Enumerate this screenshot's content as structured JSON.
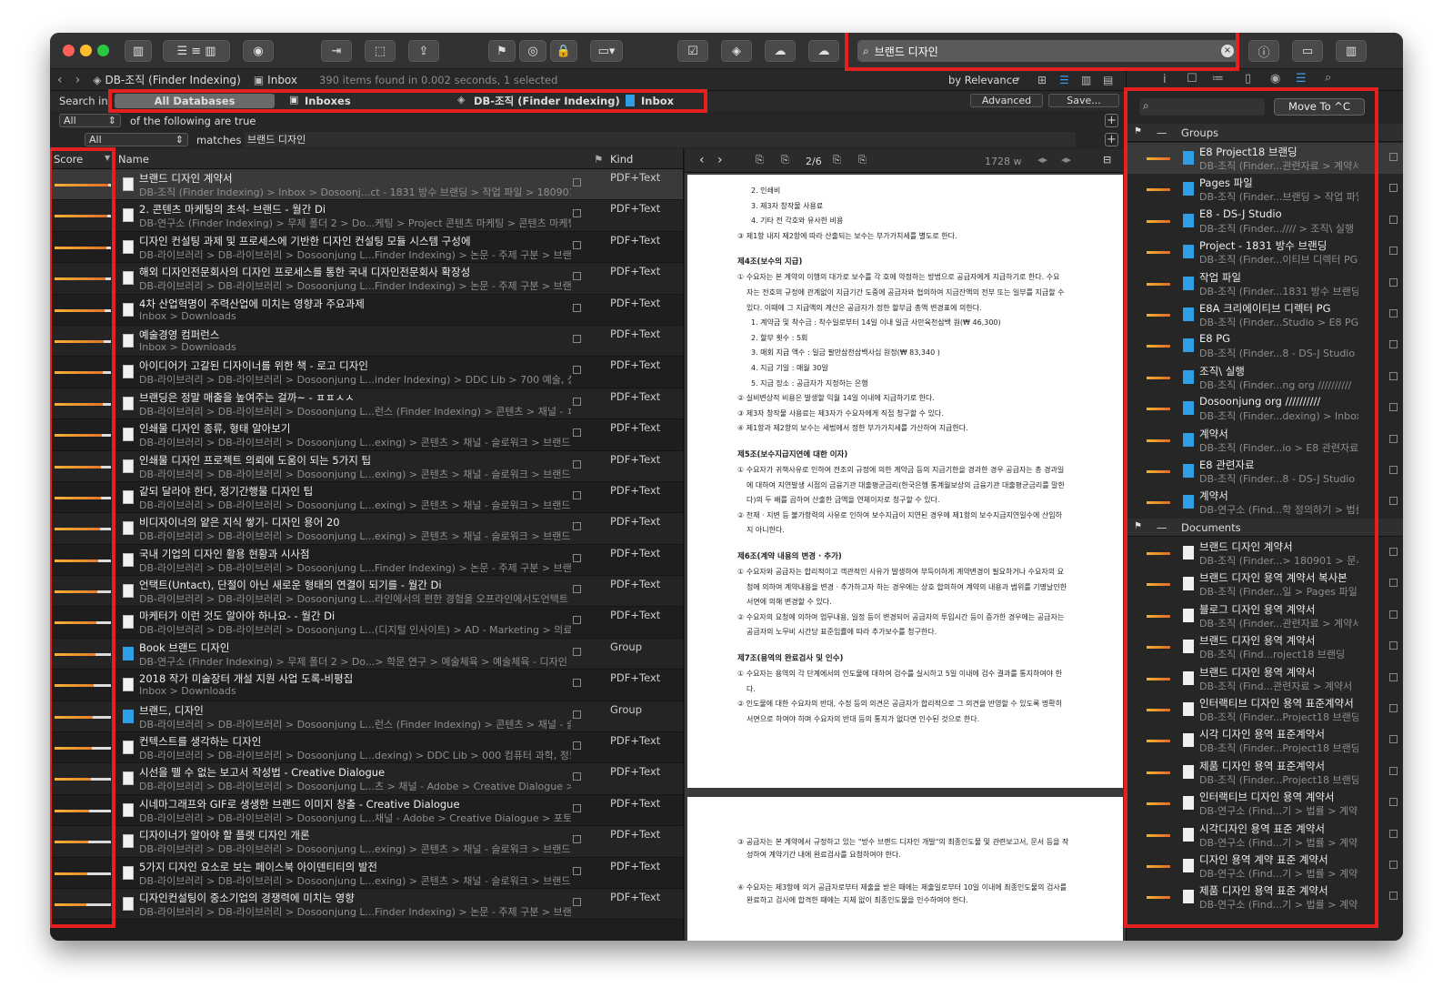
{
  "toolbar": {
    "search_value": "브랜드 디자인",
    "search_clear": "×"
  },
  "pathbar": {
    "db_label": "DB-조직 (Finder Indexing)",
    "inbox_label": "Inbox",
    "status": "390 items found in 0.002 seconds, 1 selected",
    "sort": "by Relevance"
  },
  "scope": {
    "label": "Search in:",
    "items": [
      "All Databases",
      "Inboxes",
      "DB-조직 (Finder Indexing)",
      "Inbox"
    ],
    "advanced": "Advanced",
    "save": "Save..."
  },
  "criteria": {
    "row1_select": "All",
    "row1_text": "of the following are true",
    "row2_select": "All",
    "row2_op": "matches",
    "row2_value": "브랜드 디자인"
  },
  "list": {
    "col_score": "Score",
    "col_name": "Name",
    "col_kind": "Kind",
    "rows": [
      {
        "t": "브랜드 디자인 계약서",
        "p": "DB-조직 (Finder Indexing) > Inbox > Dosoonj...ct - 1831 방수 브랜딩 > 작업 파일 > 180901 > 문서",
        "k": "PDF+Text",
        "s": 0.95
      },
      {
        "t": "2. 콘텐츠 마케팅의 초석- 브랜드 - 월간 Di",
        "p": "DB-연구소 (Finder Indexing) > 무제 폴더 2 > Do...케팅 > Project 콘텐츠 마케팅 > 콘텐츠 마케팅의 정의",
        "k": "PDF+Text",
        "s": 0.93
      },
      {
        "t": "디자인 컨설팅 과제 및 프로세스에 기반한 디자인 컨설팅 모듈 시스템 구성에",
        "p": "DB-라이브러리 > DB-라이브러리 > Dosoonjung L...Finder Indexing) > 논문 - 주제 구분 > 브랜딩 논문",
        "k": "PDF+Text",
        "s": 0.92
      },
      {
        "t": "해외 디자인전문회사의 디자인 프로세스를 통한 국내 디자인전문회사 확장성",
        "p": "DB-라이브러리 > DB-라이브러리 > Dosoonjung L...Finder Indexing) > 논문 - 주제 구분 > 브랜딩 논문",
        "k": "PDF+Text",
        "s": 0.9
      },
      {
        "t": "4차 산업혁명이 주력산업에 미치는 영향과 주요과제",
        "p": "Inbox > Downloads",
        "k": "PDF+Text",
        "s": 0.88
      },
      {
        "t": "예술경영 컴퍼런스",
        "p": "Inbox > Downloads",
        "k": "PDF+Text",
        "s": 0.87
      },
      {
        "t": "아이디어가 고갈된 디자이너를 위한 책 - 로고 디자인",
        "p": "DB-라이브러리 > DB-라이브러리 > Dosoonjung L...inder Indexing) > DDC Lib > 700 예술, 상식예술",
        "k": "PDF+Text",
        "s": 0.86
      },
      {
        "t": "브랜딩은 정말 매출을 높여주는 걸까~ - ㅍㅍㅅㅅ",
        "p": "DB-라이브러리 > DB-라이브러리 > Dosoonjung L...런스 (Finder Indexing) > 콘텐츠 > 채널 - ㅍㅍㅅㅅ",
        "k": "PDF+Text",
        "s": 0.85
      },
      {
        "t": "인쇄물 디자인 종류, 형태 알아보기",
        "p": "DB-라이브러리 > DB-라이브러리 > Dosoonjung L...exing) > 콘텐츠 > 채널 - 슬로워크 > 브랜드, 디자인",
        "k": "PDF+Text",
        "s": 0.84
      },
      {
        "t": "인쇄물 디자인 프로젝트 의뢰에 도움이 되는 5가지 팁",
        "p": "DB-라이브러리 > DB-라이브러리 > Dosoonjung L...exing) > 콘텐츠 > 채널 - 슬로워크 > 브랜드, 디자인",
        "k": "PDF+Text",
        "s": 0.83
      },
      {
        "t": "같되 달라야 한다, 정기간행물 디자인 팁",
        "p": "DB-라이브러리 > DB-라이브러리 > Dosoonjung L...exing) > 콘텐츠 > 채널 - 슬로워크 > 브랜드, 디자인",
        "k": "PDF+Text",
        "s": 0.82
      },
      {
        "t": "비디자이너의 얕은 지식 쌓기- 디자인 용어 20",
        "p": "DB-라이브러리 > DB-라이브러리 > Dosoonjung L...exing) > 콘텐츠 > 채널 - 슬로워크 > 브랜드, 디자인",
        "k": "PDF+Text",
        "s": 0.8
      },
      {
        "t": "국내 기업의 디자인 활용 현황과 시사점",
        "p": "DB-라이브러리 > DB-라이브러리 > Dosoonjung L...Finder Indexing) > 논문 - 주제 구분 > 브랜딩 논문",
        "k": "PDF+Text",
        "s": 0.78
      },
      {
        "t": "언택트(Untact), 단절이 아닌 새로운 형태의 연결이 되기를 - 월간 Di",
        "p": "DB-라이브러리 > DB-라이브러리 > Dosoonjung L...라인에서의 편한 경험을 오프라인에서도언택트 마케팅",
        "k": "PDF+Text",
        "s": 0.76
      },
      {
        "t": "마케터가 이런 것도 알아야 하나요- - 월간 Di",
        "p": "DB-라이브러리 > DB-라이브러리 > Dosoonjung L...(디지털 인사이트) > AD - Marketing > 의료 마케팅",
        "k": "PDF+Text",
        "s": 0.74
      },
      {
        "t": "Book 브랜드 디자인",
        "p": "DB-연구소 (Finder Indexing) > 무제 폴더 2 > Do...> 학문 연구 > 예술체육 > 예술체육 - 디자인 > 브랜딩",
        "k": "Group",
        "s": 0.72
      },
      {
        "t": "2018 작가 미술장터 개설 지원 사업 도록-비평집",
        "p": "Inbox > Downloads",
        "k": "PDF+Text",
        "s": 0.7
      },
      {
        "t": "브랜드, 디자인",
        "p": "DB-라이브러리 > DB-라이브러리 > Dosoonjung L...런스 (Finder Indexing) > 콘텐츠 > 채널 - 슬로워크",
        "k": "Group",
        "s": 0.68
      },
      {
        "t": "컨텍스트를 생각하는 디자인",
        "p": "DB-라이브러리 > DB-라이브러리 > Dosoonjung L...dexing) > DDC Lib > 000 컴퓨터 과학, 정보, 총류",
        "k": "PDF+Text",
        "s": 0.66
      },
      {
        "t": "시선을 뗄 수 없는 보고서 작성법 - Creative Dialogue",
        "p": "DB-라이브러리 > DB-라이브러리 > Dosoonjung L...츠 > 채널 - Adobe > Creative Dialogue > 디자인",
        "k": "PDF+Text",
        "s": 0.64
      },
      {
        "t": "시네마그래프와 GIF로 생생한 브랜드 이미지 창출 - Creative Dialogue",
        "p": "DB-라이브러리 > DB-라이브러리 > Dosoonjung L...채널 - Adobe > Creative Dialogue > 포토그래피",
        "k": "PDF+Text",
        "s": 0.62
      },
      {
        "t": "디자이너가 알아야 할 플랫 디자인 개론",
        "p": "DB-라이브러리 > DB-라이브러리 > Dosoonjung L...exing) > 콘텐츠 > 채널 - 슬로워크 > 브랜드, 디자인",
        "k": "PDF+Text",
        "s": 0.6
      },
      {
        "t": "5가지 디자인 요소로 보는 페이스북 아이덴티티의 발전",
        "p": "DB-라이브러리 > DB-라이브러리 > Dosoonjung L...exing) > 콘텐츠 > 채널 - 슬로워크 > 브랜드, 디자인",
        "k": "PDF+Text",
        "s": 0.58
      },
      {
        "t": "디자인컨설팅이 중소기업의 경쟁력에 미치는 영향",
        "p": "DB-라이브러리 > DB-라이브러리 > Dosoonjung L...Finder Indexing) > 논문 - 주제 구분 > 브랜딩 논문",
        "k": "PDF+Text",
        "s": 0.56
      }
    ]
  },
  "preview": {
    "page_label": "2/6",
    "width_label": "1728 w",
    "lines1": [
      {
        "c": "",
        "t": "2. 인쇄비"
      },
      {
        "c": "",
        "t": "3. 제3자 창작물 사용료"
      },
      {
        "c": "",
        "t": "4. 기타 전 각호와 유사한 비용"
      },
      {
        "c": "",
        "t": "③ 제1항 내지 제2항에 따라 산출되는 보수는 부가가치세를 별도로 한다."
      },
      {
        "c": "h",
        "t": "제4조(보수의 지급)"
      },
      {
        "c": "",
        "t": "① 수요자는 본 계약의 이행의 대가로 보수를 각 호에 약정하는 방법으로 공급자에게 지급하기로 한다. 수요"
      },
      {
        "c": "",
        "t": "자는 전호의 규정에 관계없이 지급기간 도중에 공급자와 협의하여 지급잔액의 전부 또는 일부를 지급할 수"
      },
      {
        "c": "",
        "t": "있다. 이때에 그 지급액의 계산은 공급자가 정한 할부금 총액 변경표에 의한다."
      },
      {
        "c": "",
        "t": "1. 계약금 및 착수금 : 착수일로부터 14일 이내 일금 사만육천삼백 원(₩ 46,300)"
      },
      {
        "c": "",
        "t": "2. 할부 횟수 : 5회"
      },
      {
        "c": "",
        "t": "3. 매회 지급 액수 : 일금 팔만삼천삼백사십 원정(₩ 83,340 )"
      },
      {
        "c": "",
        "t": "4. 지급 기일 : 매월 30일"
      },
      {
        "c": "",
        "t": "5. 지급 장소 : 공급자가 지정하는 은행"
      },
      {
        "c": "",
        "t": "② 실비변상적 비용은 발생할 익월 14일 이내에 지급하기로 한다."
      },
      {
        "c": "",
        "t": "③ 제3자 창작물 사용료는 제3자가 수요자에게 직접 청구할 수 있다."
      },
      {
        "c": "",
        "t": "④ 제1항과 제2항의 보수는 세법에서 정한 부가가치세를 가산하여 지급한다."
      },
      {
        "c": "h",
        "t": "제5조(보수지급지연에 대한 이자)"
      },
      {
        "c": "",
        "t": "① 수요자가 귀책사유로 인하여 전조의 규정에 의한 계약금 등의 지급기한을 경과한 경우 공급자는 총 경과일"
      },
      {
        "c": "",
        "t": "에 대하여 지연발생 시점의 금융기관 대출평균금리(한국은행 통계월보상의 금융기관 대출평균금리를 말한"
      },
      {
        "c": "",
        "t": "다)의 두 배를 곱하여 산출한 금액을 연체이자로 청구할 수 있다."
      },
      {
        "c": "",
        "t": "② 천재 · 지변 등 불가항력의 사유로 인하여 보수지급이 지연된 경우에 제1항의 보수지급지연일수에 산입하"
      },
      {
        "c": "",
        "t": "지 아니한다."
      },
      {
        "c": "h",
        "t": "제6조(계약 내용의 변경 · 추가)"
      },
      {
        "c": "",
        "t": "① 수요자와 공급자는 합리적이고 객관적인 사유가 발생하여 부득이하게 계약변경이 필요하거나 수요자의 요"
      },
      {
        "c": "",
        "t": "청에 의하여 계약내용을 변경 · 추가하고자 하는 경우에는 상호 합의하여 계약의 내용과 범위를 기명날인한"
      },
      {
        "c": "",
        "t": "서면에 의해 변경할 수 있다."
      },
      {
        "c": "",
        "t": "② 수요자의 요청에 의하여 업무내용, 일정 등이 변경되어 공급자의 투입시간 등이 증가한 경우에는 공급자는"
      },
      {
        "c": "",
        "t": "공급자의 노무비 시간당 표준임률에 따라 추가보수를 청구한다."
      },
      {
        "c": "h",
        "t": "제7조(용역의 완료검사 및 인수)"
      },
      {
        "c": "",
        "t": "① 수요자는 용역의 각 단계에서의 인도물에 대하여 검수를 실시하고 5일 이내에 검수 결과를 통지하여야 한"
      },
      {
        "c": "",
        "t": "다."
      },
      {
        "c": "",
        "t": "② 인도물에 대한 수요자의 반대, 수정 등의 의견은 공급자가 합리적으로 그 의견을 반영할 수 있도록 명확히"
      },
      {
        "c": "",
        "t": "서면으로 하여야 하며 수요자의 반대 등의 통지가 없다면 인수된 것으로 한다."
      }
    ],
    "lines2": [
      {
        "t": "③ 공급자는 본 계약에서 규정하고 있는 \"방수 브랜드 디자인 개발\"의 최종인도물 및 관련보고서, 문서 등을 작"
      },
      {
        "t": "성하여 계약기간 내에 완료검사를 요청하여야 한다."
      },
      {
        "t": "④ 수요자는 제3항에 의거 공급자로부터 제출을 받은 때에는 제출일로부터 10일 이내에 최종인도물의 검사를"
      },
      {
        "t": "완료하고 검사에 합격한 때에는 지체 없이 최종인도물을 인수하여야 한다."
      }
    ]
  },
  "inspector": {
    "move_to": "Move To ^C",
    "groups_label": "Groups",
    "documents_label": "Documents",
    "groups": [
      {
        "a": "E8 Project18 브랜딩",
        "b": "DB-조직 (Finder...관련자료 > 계약서"
      },
      {
        "a": "Pages 파일",
        "b": "DB-조직 (Finder...브랜딩 > 작업 파일"
      },
      {
        "a": "E8 - DS-J Studio",
        "b": "DB-조직 (Finder...//// > 조직\\ 실행"
      },
      {
        "a": "Project - 1831 방수 브랜딩",
        "b": "DB-조직 (Finder...이티브 디렉터 PG"
      },
      {
        "a": "작업 파일",
        "b": "DB-조직 (Finder...1831 방수 브랜딩"
      },
      {
        "a": "E8A 크리에이티브 디렉터 PG",
        "b": "DB-조직 (Finder...Studio > E8 PG"
      },
      {
        "a": "E8 PG",
        "b": "DB-조직 (Finder...8 - DS-J Studio"
      },
      {
        "a": "조직\\ 실행",
        "b": "DB-조직 (Finder...ng org //////////"
      },
      {
        "a": "Dosoonjung org //////////",
        "b": "DB-조직 (Finder...dexing) > Inbox"
      },
      {
        "a": "계약서",
        "b": "DB-조직 (Finder...io > E8 관련자료"
      },
      {
        "a": "E8 관련자료",
        "b": "DB-조직 (Finder...8 - DS-J Studio"
      },
      {
        "a": "계약서",
        "b": "DB-연구소 (Find...학 정의하기 > 법률"
      }
    ],
    "documents": [
      {
        "a": "브랜드 디자인 계약서",
        "b": "DB-조직 (Finder...> 180901 > 문서"
      },
      {
        "a": "브랜드 디자인 용역 계약서 복사본",
        "b": "DB-조직 (Finder...일 > Pages 파일"
      },
      {
        "a": "블로그 디자인 용역 계약서",
        "b": "DB-조직 (Finder...관련자료 > 계약서"
      },
      {
        "a": "브랜드 디자인 용역 계약서",
        "b": "DB-조직 (Find...roject18 브랜딩"
      },
      {
        "a": "브랜드 디자인 용역 계약서",
        "b": "DB-조직 (Find...관련자료 > 계약서"
      },
      {
        "a": "인터랙티브 디자인 용역 표준계약서",
        "b": "DB-조직 (Finder...Project18 브랜딩"
      },
      {
        "a": "시각 디자인 용역 표준계약서",
        "b": "DB-조직 (Finder...Project18 브랜딩"
      },
      {
        "a": "제품 디자인 용역 표준계약서",
        "b": "DB-조직 (Finder...Project18 브랜딩"
      },
      {
        "a": "인터랙티브 디자인 용역 계약서",
        "b": "DB-연구소 (Find...기 > 법률 > 계약서"
      },
      {
        "a": "시각디자인 용역 표준 계약서",
        "b": "DB-연구소 (Find...기 > 법률 > 계약서"
      },
      {
        "a": "디자인 용역 계약 표준 계약서",
        "b": "DB-연구소 (Find...기 > 법률 > 계약서"
      },
      {
        "a": "제품 디자인 용역 표준 계약서",
        "b": "DB-연구소 (Find...기 > 법률 > 계약서"
      }
    ]
  }
}
